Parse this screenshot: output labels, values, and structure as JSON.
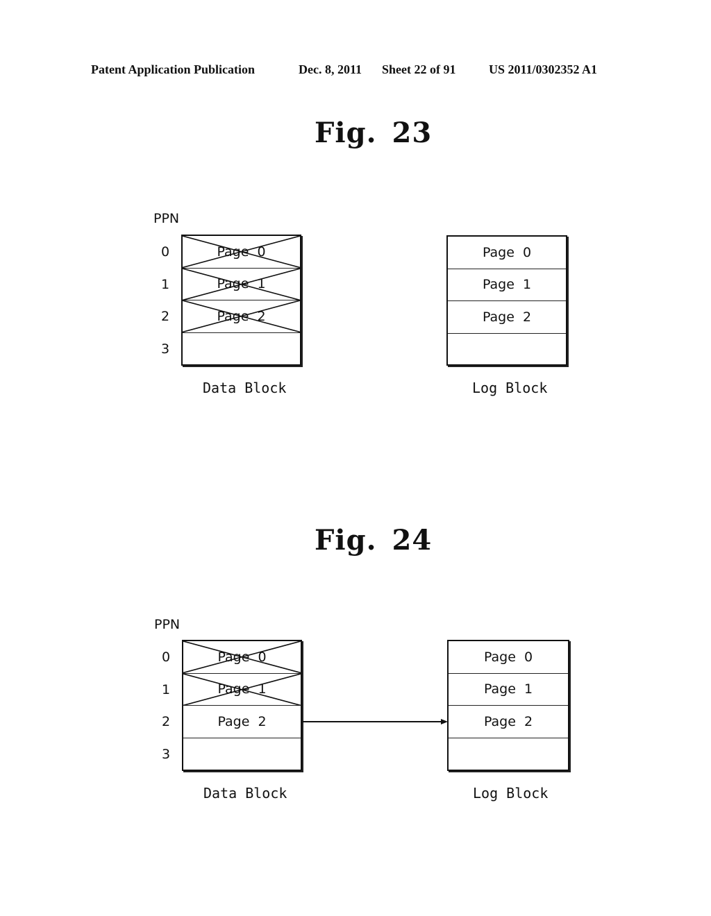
{
  "header": {
    "publication": "Patent Application Publication",
    "date": "Dec. 8, 2011",
    "sheet": "Sheet 22 of 91",
    "number": "US 2011/0302352 A1"
  },
  "figures": [
    {
      "label": "Fig.",
      "number": "23",
      "ppn_label": "PPN",
      "rows": [
        "0",
        "1",
        "2",
        "3"
      ],
      "data_block": {
        "caption": "Data Block",
        "cells": [
          {
            "text": "Page 0",
            "invalidated": true
          },
          {
            "text": "Page 1",
            "invalidated": true
          },
          {
            "text": "Page 2",
            "invalidated": true
          },
          {
            "text": "",
            "invalidated": false
          }
        ]
      },
      "log_block": {
        "caption": "Log Block",
        "cells": [
          {
            "text": "Page 0"
          },
          {
            "text": "Page 1"
          },
          {
            "text": "Page 2"
          },
          {
            "text": ""
          }
        ]
      },
      "arrow": null
    },
    {
      "label": "Fig.",
      "number": "24",
      "ppn_label": "PPN",
      "rows": [
        "0",
        "1",
        "2",
        "3"
      ],
      "data_block": {
        "caption": "Data Block",
        "cells": [
          {
            "text": "Page 0",
            "invalidated": true
          },
          {
            "text": "Page 1",
            "invalidated": true
          },
          {
            "text": "Page 2",
            "invalidated": false
          },
          {
            "text": "",
            "invalidated": false
          }
        ]
      },
      "log_block": {
        "caption": "Log Block",
        "cells": [
          {
            "text": "Page 0"
          },
          {
            "text": "Page 1"
          },
          {
            "text": "Page 2"
          },
          {
            "text": ""
          }
        ]
      },
      "arrow": {
        "from": "data_block.page_2",
        "to": "log_block.page_2"
      }
    }
  ]
}
